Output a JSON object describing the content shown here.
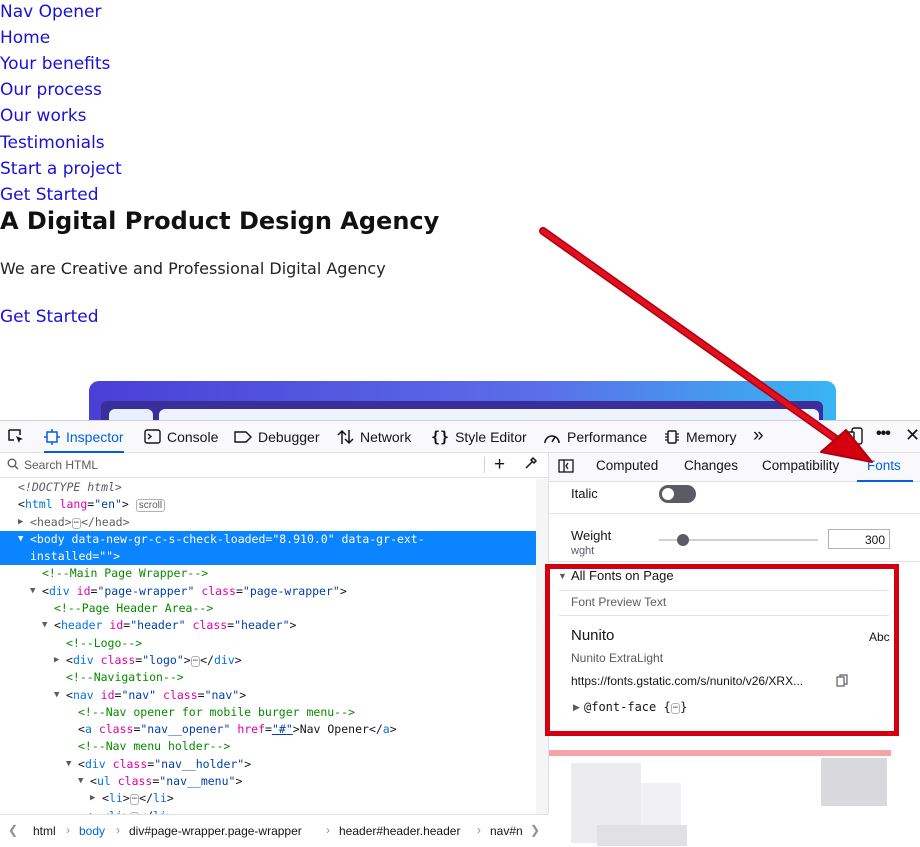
{
  "page": {
    "nav_links": [
      "Nav Opener",
      "Home",
      "Your benefits",
      "Our process",
      "Our works",
      "Testimonials",
      "Start a project",
      "Get Started"
    ],
    "hero_title": "A Digital Product Design Agency",
    "hero_subtitle": "We are Creative and Professional Digital Agency",
    "hero_cta": "Get Started"
  },
  "devtools": {
    "tabs": [
      "Inspector",
      "Console",
      "Debugger",
      "Network",
      "Style Editor",
      "Performance",
      "Memory"
    ],
    "active_tab": "Inspector",
    "search_placeholder": "Search HTML",
    "markup": {
      "doctype": "<!DOCTYPE html>",
      "html_open": {
        "tag": "html",
        "attr": "lang",
        "val": "\"en\"",
        "badge": "scroll"
      },
      "head": "head",
      "body_line1": "<body data-new-gr-c-s-check-loaded=\"8.910.0\" data-gr-ext-",
      "body_line2": "installed=\"\">",
      "c_main": "<!--Main Page Wrapper-->",
      "div_wrapper": {
        "id": "\"page-wrapper\"",
        "class": "\"page-wrapper\""
      },
      "c_header": "<!--Page Header Area-->",
      "header": {
        "id": "\"header\"",
        "class": "\"header\""
      },
      "c_logo": "<!--Logo-->",
      "div_logo": {
        "class": "\"logo\""
      },
      "c_nav": "<!--Navigation-->",
      "nav": {
        "id": "\"nav\"",
        "class": "\"nav\""
      },
      "c_opener": "<!--Nav opener for mobile burger menu-->",
      "a_opener": {
        "class": "\"nav__opener\"",
        "href": "\"#\"",
        "text": "Nav Opener"
      },
      "c_holder": "<!--Nav menu holder-->",
      "div_holder": {
        "class": "\"nav__holder\""
      },
      "ul_menu": {
        "class": "\"nav__menu\""
      }
    },
    "breadcrumb": [
      "html",
      "body",
      "div#page-wrapper.page-wrapper",
      "header#header.header",
      "nav#n"
    ],
    "breadcrumb_active": "body",
    "right_tabs": [
      "Computed",
      "Changes",
      "Compatibility",
      "Fonts"
    ],
    "right_active": "Fonts",
    "fonts": {
      "italic_label": "Italic",
      "weight_label": "Weight",
      "weight_axis": "wght",
      "weight_value": "300",
      "weight_fraction": 0.12,
      "all_fonts_label": "All Fonts on Page",
      "preview_text": "Font Preview Text",
      "font_name": "Nunito",
      "font_sample": "Abc",
      "font_variant": "Nunito ExtraLight",
      "font_url": "https://fonts.gstatic.com/s/nunito/v26/XRX...",
      "font_face": "@font-face {",
      "font_face_close": "}"
    }
  },
  "colors": {
    "link": "#1a10d8",
    "accent": "#0061e0",
    "highlight": "#d4000f",
    "selection": "#0a84ff"
  }
}
